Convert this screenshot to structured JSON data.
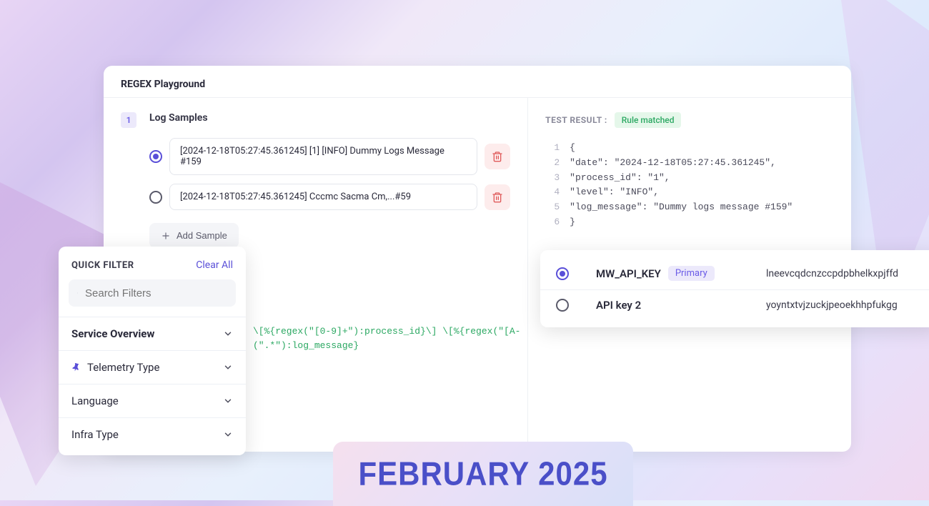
{
  "regex_panel": {
    "title": "REGEX Playground",
    "section1_num": "1",
    "section1_title": "Log Samples",
    "samples": [
      {
        "selected": true,
        "text": "[2024-12-18T05:27:45.361245] [1] [INFO] Dummy Logs Message #159"
      },
      {
        "selected": false,
        "text": "[2024-12-18T05:27:45.361245] Cccmc Sacma Cm,...#59"
      }
    ],
    "add_sample_label": "Add Sample",
    "test_result_label": "TEST RESULT :",
    "test_result_badge": "Rule matched",
    "code_lines": [
      "{",
      "  \"date\": \"2024-12-18T05:27:45.361245\",",
      "  \"process_id\": \"1\",",
      "  \"level\": \"INFO\",",
      "  \"log_message\": \"Dummy logs message #159\"",
      "}"
    ],
    "regex_snippet_line1": "\\[%{regex(\"[0-9]+\"):process_id}\\] \\[%{regex(\"[A-",
    "regex_snippet_line2": "(\".*\"):log_message}"
  },
  "quick_filter": {
    "title": "QUICK FILTER",
    "clear_all": "Clear All",
    "search_placeholder": "Search Filters",
    "items": [
      {
        "label": "Service Overview",
        "pinned": false,
        "primary": true
      },
      {
        "label": "Telemetry Type",
        "pinned": true,
        "primary": false
      },
      {
        "label": "Language",
        "pinned": false,
        "primary": false
      },
      {
        "label": "Infra Type",
        "pinned": false,
        "primary": false
      }
    ]
  },
  "api_keys": {
    "rows": [
      {
        "selected": true,
        "name": "MW_API_KEY",
        "primary": true,
        "primary_label": "Primary",
        "value": "lneevcqdcnzccpdpbhelkxpjffd"
      },
      {
        "selected": false,
        "name": "API key 2",
        "primary": false,
        "value": "yoyntxtvjzuckjpeoekhhpfukgg"
      }
    ]
  },
  "banner": {
    "text": "FEBRUARY 2025"
  }
}
